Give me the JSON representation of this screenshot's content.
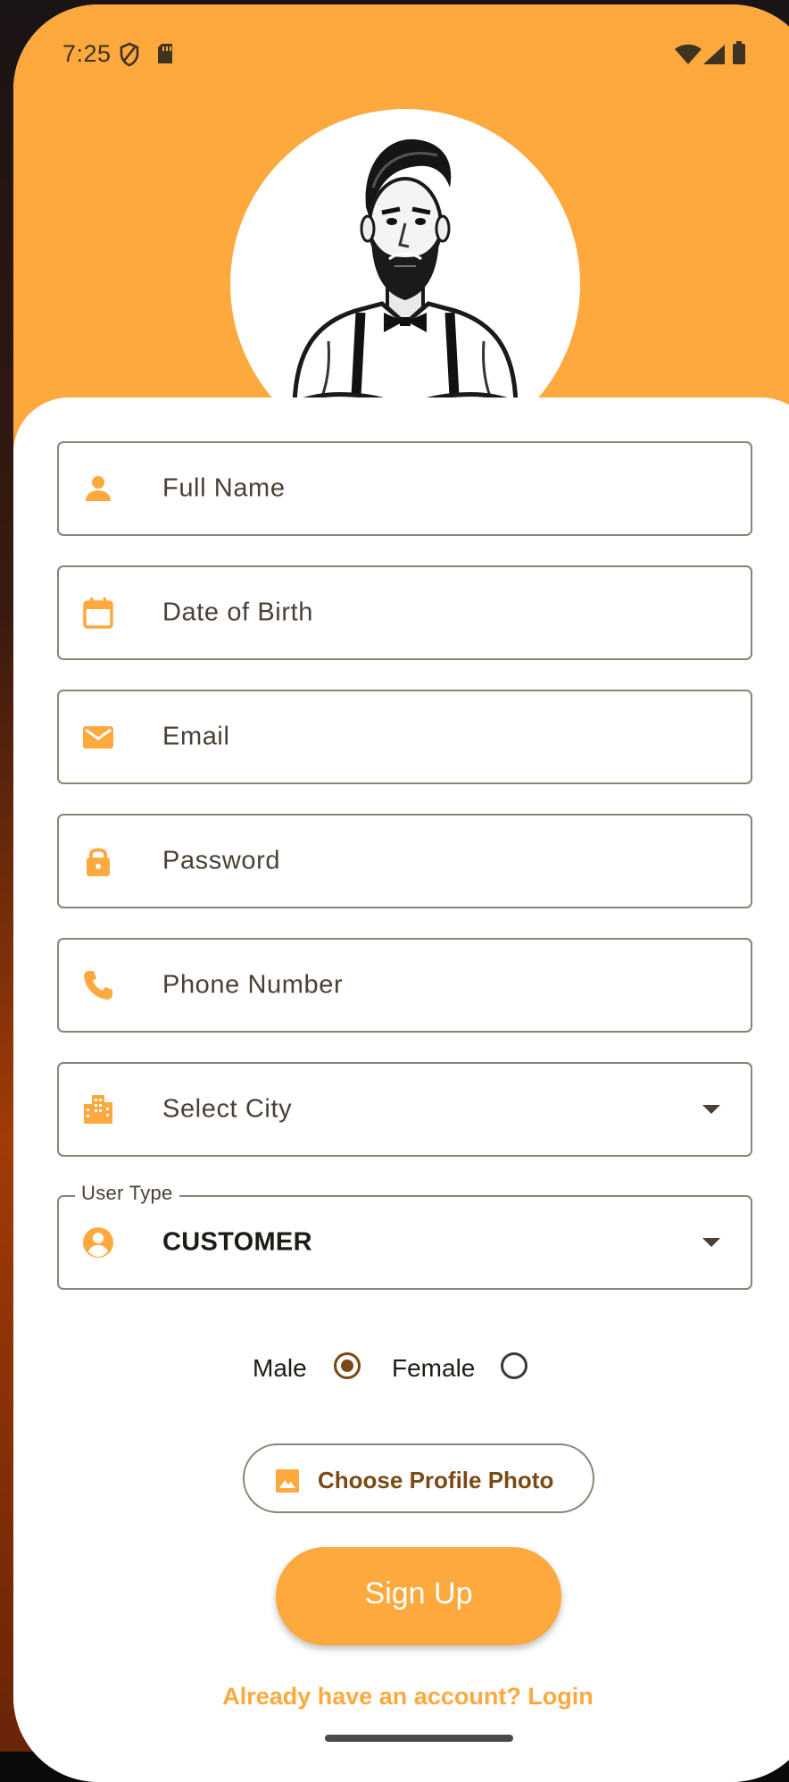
{
  "status_bar": {
    "time": "7:25",
    "icons": [
      "shield-icon",
      "sd-card-icon",
      "wifi-icon",
      "signal-icon",
      "battery-icon"
    ]
  },
  "colors": {
    "accent": "#fea93e",
    "brown_accent": "#7a4a14",
    "text": "#4a4036",
    "border": "#8c8376"
  },
  "avatar": {
    "icon": "bearded-man-illustration"
  },
  "form": {
    "full_name": {
      "placeholder": "Full Name",
      "icon": "person-icon"
    },
    "date_of_birth": {
      "placeholder": "Date of Birth",
      "icon": "calendar-icon"
    },
    "email": {
      "placeholder": "Email",
      "icon": "mail-icon"
    },
    "password": {
      "placeholder": "Password",
      "icon": "lock-icon"
    },
    "phone": {
      "placeholder": "Phone Number",
      "icon": "phone-icon"
    },
    "city": {
      "placeholder": "Select City",
      "icon": "city-icon"
    },
    "user_type": {
      "label": "User Type",
      "value": "CUSTOMER",
      "icon": "account-circle-icon"
    }
  },
  "gender": {
    "male_label": "Male",
    "female_label": "Female",
    "selected": "Male"
  },
  "photo_button": {
    "label": "Choose Profile Photo",
    "icon": "image-icon"
  },
  "signup_button": {
    "label": "Sign Up"
  },
  "login_link": {
    "label": "Already have an account? Login"
  }
}
